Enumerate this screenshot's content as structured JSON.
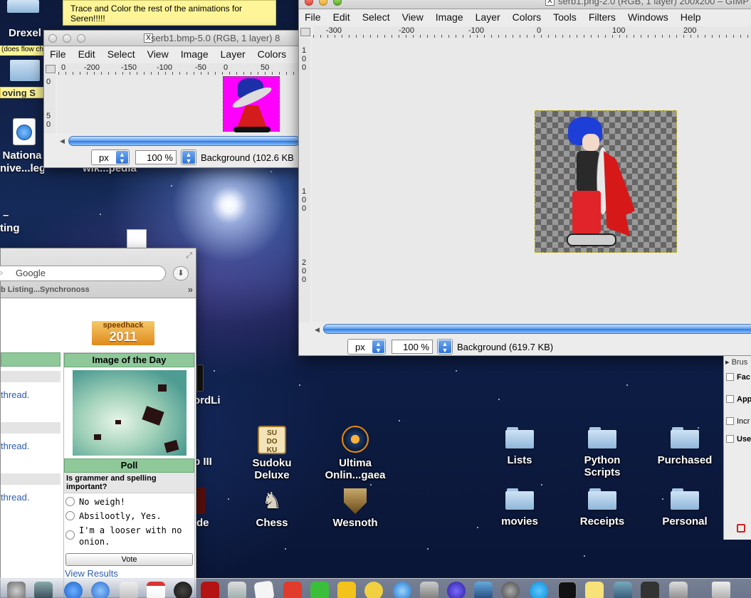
{
  "desktop": {
    "sidebar_labels": {
      "drexel": "Drexel",
      "flow_chart": "(does flow ch",
      "moving": "oving S",
      "national_line1": "Nationa",
      "national_line2": "nive...leges",
      "wikipedia": "wik...pedia",
      "dash": "–",
      "ting": "ting"
    },
    "icons": [
      {
        "name": "sudoku",
        "line1": "Sudoku",
        "line2": "Deluxe"
      },
      {
        "name": "ultima",
        "line1": "Ultima",
        "line2": "Onlin...gaea"
      },
      {
        "name": "lists",
        "line1": "Lists",
        "line2": ""
      },
      {
        "name": "python",
        "line1": "Python",
        "line2": "Scripts"
      },
      {
        "name": "purchased",
        "line1": "Purchased",
        "line2": ""
      },
      {
        "name": "chess",
        "line1": "Chess",
        "line2": ""
      },
      {
        "name": "wesnoth",
        "line1": "Wesnoth",
        "line2": ""
      },
      {
        "name": "movies",
        "line1": "movies",
        "line2": ""
      },
      {
        "name": "receipts",
        "line1": "Receipts",
        "line2": ""
      },
      {
        "name": "personal",
        "line1": "Personal",
        "line2": ""
      }
    ],
    "partial_labels": {
      "ordli": "ordLi",
      "iii": "b III",
      "de": "de"
    }
  },
  "sticky_note": {
    "text": "Trace and Color the rest of the animations for Seren!!!!!"
  },
  "gimp_small": {
    "title": "serb1.bmp-5.0 (RGB, 1 layer) 8",
    "menu": [
      "File",
      "Edit",
      "Select",
      "View",
      "Image",
      "Layer",
      "Colors"
    ],
    "ruler_h": [
      "0",
      "-200",
      "-150",
      "-100",
      "-50",
      "0",
      "50"
    ],
    "ruler_v": [
      "0",
      "5",
      "0"
    ],
    "unit": "px",
    "zoom": "100 %",
    "status": "Background (102.6 KB"
  },
  "gimp_large": {
    "title": "serb1.png-2.0 (RGB, 1 layer) 200x200 – GIMP",
    "menu": [
      "File",
      "Edit",
      "Select",
      "View",
      "Image",
      "Layer",
      "Colors",
      "Tools",
      "Filters",
      "Windows",
      "Help"
    ],
    "ruler_h": [
      "-300",
      "-200",
      "-100",
      "0",
      "100",
      "200"
    ],
    "ruler_v": [
      "1",
      "0",
      "0",
      "1",
      "0",
      "0",
      "2",
      "0",
      "0"
    ],
    "unit": "px",
    "zoom": "100 %",
    "status": "Background (619.7 KB)"
  },
  "gimp_toolbox_partial": {
    "brush_label": "Brus",
    "options": [
      "Fac",
      "App",
      "Incr",
      "Use"
    ]
  },
  "safari": {
    "search_placeholder": "Google",
    "bookmarks": "b Listing...Synchronoss",
    "logo_top": "speedhack",
    "logo_year": "2011",
    "thread_links": [
      "thread.",
      "thread.",
      "thread."
    ],
    "iotd_heading": "Image of the Day",
    "poll_heading": "Poll",
    "poll_question": "Is grammer and spelling important?",
    "poll_options": [
      "No weigh!",
      "Absilootly, Yes.",
      "I'm a looser with no onion."
    ],
    "vote_label": "Vote",
    "view_results": "View Results"
  },
  "colors": {
    "accent": "#2d7ae0",
    "panel_green": "#8fc99a",
    "note_yellow": "#fdf597",
    "link_blue": "#2a5db0"
  }
}
